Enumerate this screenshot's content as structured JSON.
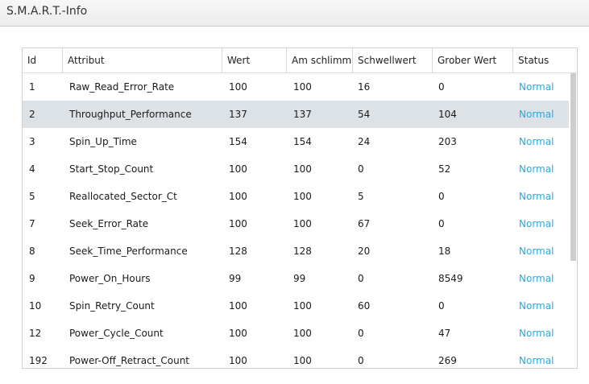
{
  "window": {
    "title": "S.M.A.R.T.-Info"
  },
  "table": {
    "columns": [
      "Id",
      "Attribut",
      "Wert",
      "Am schlimmsten",
      "Schwellwert",
      "Grober Wert",
      "Status"
    ],
    "rows": [
      [
        "1",
        "Raw_Read_Error_Rate",
        "100",
        "100",
        "16",
        "0",
        "Normal"
      ],
      [
        "2",
        "Throughput_Performance",
        "137",
        "137",
        "54",
        "104",
        "Normal"
      ],
      [
        "3",
        "Spin_Up_Time",
        "154",
        "154",
        "24",
        "203",
        "Normal"
      ],
      [
        "4",
        "Start_Stop_Count",
        "100",
        "100",
        "0",
        "52",
        "Normal"
      ],
      [
        "5",
        "Reallocated_Sector_Ct",
        "100",
        "100",
        "5",
        "0",
        "Normal"
      ],
      [
        "7",
        "Seek_Error_Rate",
        "100",
        "100",
        "67",
        "0",
        "Normal"
      ],
      [
        "8",
        "Seek_Time_Performance",
        "128",
        "128",
        "20",
        "18",
        "Normal"
      ],
      [
        "9",
        "Power_On_Hours",
        "99",
        "99",
        "0",
        "8549",
        "Normal"
      ],
      [
        "10",
        "Spin_Retry_Count",
        "100",
        "100",
        "60",
        "0",
        "Normal"
      ],
      [
        "12",
        "Power_Cycle_Count",
        "100",
        "100",
        "0",
        "47",
        "Normal"
      ],
      [
        "192",
        "Power-Off_Retract_Count",
        "100",
        "100",
        "0",
        "269",
        "Normal"
      ]
    ],
    "selected_row": 1
  },
  "colors": {
    "status": "#2ea7d8",
    "selection": "#dde2e7"
  }
}
